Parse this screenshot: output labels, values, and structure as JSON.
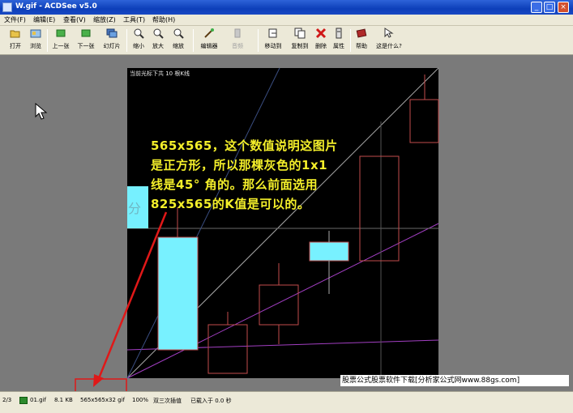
{
  "window": {
    "title": "W.gif - ACDSee v5.0",
    "minimize": "_",
    "maximize": "□",
    "close": "×"
  },
  "menu": [
    {
      "label": "文件(F)"
    },
    {
      "label": "编辑(E)"
    },
    {
      "label": "查看(V)"
    },
    {
      "label": "缩放(Z)"
    },
    {
      "label": "工具(T)"
    },
    {
      "label": "帮助(H)"
    }
  ],
  "toolbar": [
    {
      "id": "open",
      "label": "打开",
      "icon": "open-folder-icon"
    },
    {
      "id": "browse",
      "label": "浏览",
      "icon": "browse-icon"
    },
    {
      "id": "prev",
      "label": "上一张",
      "icon": "prev-image-icon"
    },
    {
      "id": "next",
      "label": "下一张",
      "icon": "next-image-icon"
    },
    {
      "id": "slideshow",
      "label": "幻灯片",
      "icon": "slideshow-icon"
    },
    {
      "id": "zoom-out",
      "label": "缩小",
      "icon": "zoom-out-icon"
    },
    {
      "id": "zoom-in",
      "label": "放大",
      "icon": "zoom-in-icon"
    },
    {
      "id": "zoom",
      "label": "缩放",
      "icon": "zoom-icon"
    },
    {
      "id": "editor",
      "label": "编辑器",
      "icon": "wand-icon"
    },
    {
      "id": "sound",
      "label": "音频",
      "icon": "speaker-icon",
      "disabled": true
    },
    {
      "id": "move",
      "label": "移动到",
      "icon": "move-to-icon"
    },
    {
      "id": "copy",
      "label": "复制到",
      "icon": "copy-to-icon"
    },
    {
      "id": "delete",
      "label": "删除",
      "icon": "delete-icon"
    },
    {
      "id": "props",
      "label": "属性",
      "icon": "properties-icon"
    },
    {
      "id": "help",
      "label": "帮助",
      "icon": "help-book-icon"
    },
    {
      "id": "whatsthis",
      "label": "这是什么?",
      "icon": "whats-this-icon"
    }
  ],
  "image": {
    "caption": "当前光标下共 10 根K线",
    "side_char": "分",
    "note_lines": [
      "565x565，这个数值说明这图片",
      "是正方形，所以那棵灰色的1x1",
      "线是45° 角的。那么前面选用",
      "825x565的K值是可以的。"
    ]
  },
  "watermark": "股票公式股票软件下载[分析家公式网www.88gs.com]",
  "status": {
    "index": "2/3",
    "filename": "01.gif",
    "filesize": "8.1 KB",
    "dimensions": "565x565x32 gif",
    "zoom": "100%",
    "interp": "双三次插值",
    "loadtime": "已载入于 0.0 秒"
  },
  "colors": {
    "candle_fill": "#78f1ff",
    "candle_outline": "#c24b4b",
    "annotation_arrow": "#e01818",
    "note_text": "#f4ef2a"
  }
}
